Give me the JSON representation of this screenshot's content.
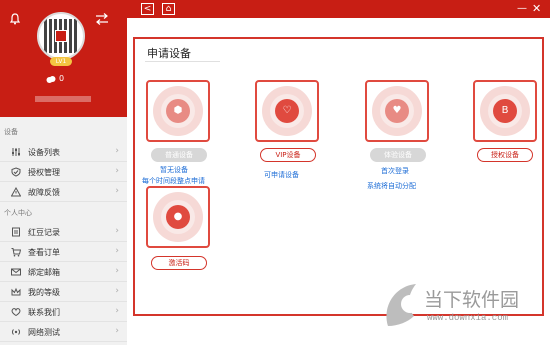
{
  "sidebar": {
    "coin_count": "0",
    "level": "LV1",
    "section_device": "设备",
    "section_personal": "个人中心",
    "items": [
      {
        "label": "设备列表",
        "icon": "sliders-icon"
      },
      {
        "label": "授权管理",
        "icon": "shield-check-icon"
      },
      {
        "label": "故障反馈",
        "icon": "warning-icon"
      },
      {
        "label": "红豆记录",
        "icon": "document-icon"
      },
      {
        "label": "查看订单",
        "icon": "cart-icon"
      },
      {
        "label": "绑定邮箱",
        "icon": "mail-icon"
      },
      {
        "label": "我的等级",
        "icon": "crown-icon"
      },
      {
        "label": "联系我们",
        "icon": "heart-chat-icon"
      },
      {
        "label": "网络测试",
        "icon": "signal-icon"
      }
    ]
  },
  "topbar": {
    "back": "<",
    "home": "⌂",
    "minimize": "—",
    "close": "✕"
  },
  "panel": {
    "title": "申请设备",
    "devices": [
      {
        "button": "普通设备",
        "button_style": "grey",
        "note1": "暂无设备",
        "note2": "每个时间段整点申请"
      },
      {
        "button": "VIP设备",
        "button_style": "red",
        "note1": "可申请设备",
        "note2": ""
      },
      {
        "button": "体验设备",
        "button_style": "grey",
        "note1": "首次登录",
        "note2": "系统将自动分配"
      },
      {
        "button": "授权设备",
        "button_style": "red",
        "note1": "",
        "note2": ""
      },
      {
        "button": "激活码",
        "button_style": "red",
        "note1": "",
        "note2": ""
      }
    ]
  },
  "watermark": {
    "text": "当下软件园",
    "url": "www.downxia.com"
  },
  "colors": {
    "brand_red": "#c81e14",
    "link_blue": "#1a6bd6"
  }
}
